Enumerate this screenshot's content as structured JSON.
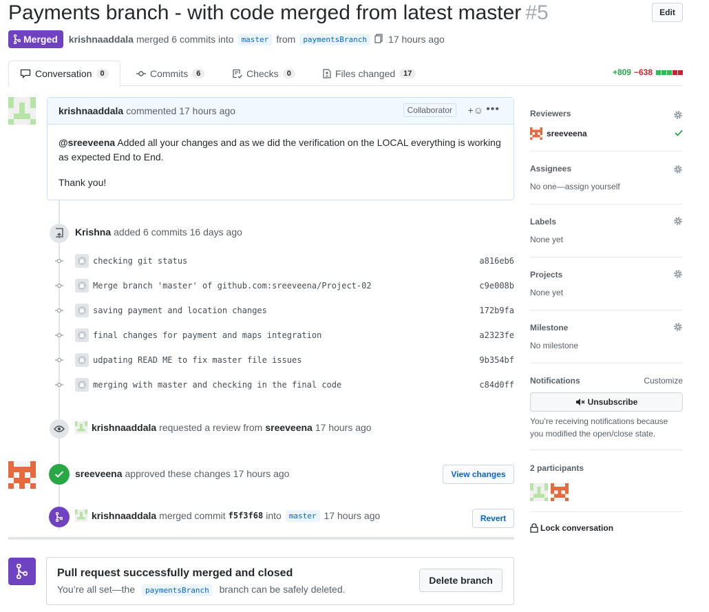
{
  "header": {
    "title": "Payments branch - with code merged from latest master",
    "number": "#5",
    "edit_label": "Edit",
    "state_label": "Merged",
    "author": "krishnaaddala",
    "meta_merged": "merged 6 commits into",
    "base_branch": "master",
    "from": "from",
    "head_branch": "paymentsBranch",
    "time": "17 hours ago"
  },
  "tabs": [
    {
      "label": "Conversation",
      "count": "0"
    },
    {
      "label": "Commits",
      "count": "6"
    },
    {
      "label": "Checks",
      "count": "0"
    },
    {
      "label": "Files changed",
      "count": "17"
    }
  ],
  "diffstat": {
    "additions": "+809",
    "deletions": "−638"
  },
  "comment": {
    "author": "krishnaaddala",
    "action": "commented 17 hours ago",
    "badge": "Collaborator",
    "mention": "@sreeveena",
    "line1": " Added all your changes and as we did the verification on the LOCAL everything is working as expected End to End.",
    "line2": "Thank you!"
  },
  "commits_event": {
    "author": "Krishna",
    "text": "added 6 commits 16 days ago"
  },
  "commits": [
    {
      "message": "checking git status",
      "sha": "a816eb6"
    },
    {
      "message": "Merge branch 'master' of github.com:sreeveena/Project-02",
      "sha": "c9e008b"
    },
    {
      "message": "saving payment and location changes",
      "sha": "172b9fa"
    },
    {
      "message": "final changes for payment and maps integration",
      "sha": "a2323fe"
    },
    {
      "message": "udpating READ ME to fix master file issues",
      "sha": "9b354bf"
    },
    {
      "message": "merging with master and checking in the final code",
      "sha": "c84d0ff"
    }
  ],
  "review_request": {
    "author": "krishnaaddala",
    "text": "requested a review from",
    "reviewer": "sreeveena",
    "time": "17 hours ago"
  },
  "approval": {
    "author": "sreeveena",
    "text": "approved these changes 17 hours ago",
    "button": "View changes"
  },
  "merge_event": {
    "author": "krishnaaddala",
    "text": "merged commit",
    "sha": "f5f3f68",
    "into": "into",
    "branch": "master",
    "time": "17 hours ago",
    "button": "Revert"
  },
  "merge_box": {
    "title": "Pull request successfully merged and closed",
    "sub_before": "You’re all set—the",
    "branch": "paymentsBranch",
    "sub_after": "branch can be safely deleted.",
    "button": "Delete branch"
  },
  "sidebar": {
    "reviewers": {
      "label": "Reviewers",
      "name": "sreeveena"
    },
    "assignees": {
      "label": "Assignees",
      "value": "No one—assign yourself"
    },
    "labels": {
      "label": "Labels",
      "value": "None yet"
    },
    "projects": {
      "label": "Projects",
      "value": "None yet"
    },
    "milestone": {
      "label": "Milestone",
      "value": "No milestone"
    },
    "notifications": {
      "label": "Notifications",
      "customize": "Customize",
      "button": "Unsubscribe",
      "note": "You’re receiving notifications because you modified the open/close state."
    },
    "participants": {
      "label": "2 participants"
    },
    "lock": "Lock conversation"
  },
  "colors": {
    "merged": "#6f42c1",
    "approved": "#28a745",
    "link": "#0366d6"
  }
}
